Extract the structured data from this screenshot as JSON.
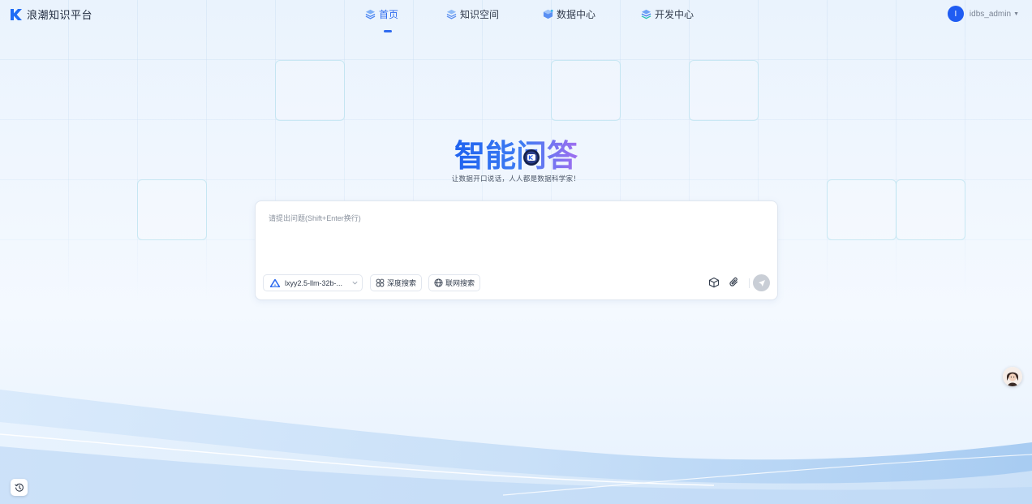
{
  "app": {
    "name": "浪潮知识平台",
    "logo_icon": "k-logo-icon"
  },
  "nav": {
    "items": [
      {
        "label": "首页",
        "icon": "layers-icon",
        "active": true
      },
      {
        "label": "知识空间",
        "icon": "layers-icon",
        "active": false
      },
      {
        "label": "数据中心",
        "icon": "cube-icon",
        "active": false
      },
      {
        "label": "开发中心",
        "icon": "stack-icon",
        "active": false
      }
    ]
  },
  "user": {
    "avatar_letter": "I",
    "name": "idbs_admin"
  },
  "hero": {
    "title": "智能问答",
    "subtitle": "让数据开口说话，人人都是数据科学家！"
  },
  "chat": {
    "placeholder": "请提出问题(Shift+Enter换行)",
    "model": "lxyy2.5-llm-32b-...",
    "deep_search_label": "深度搜索",
    "web_search_label": "联网搜索"
  },
  "colors": {
    "accent": "#2f6bef",
    "avatar_bg": "#1f5cf2",
    "title_gradient_start": "#1f63f0",
    "title_gradient_end": "#a16ef0"
  }
}
